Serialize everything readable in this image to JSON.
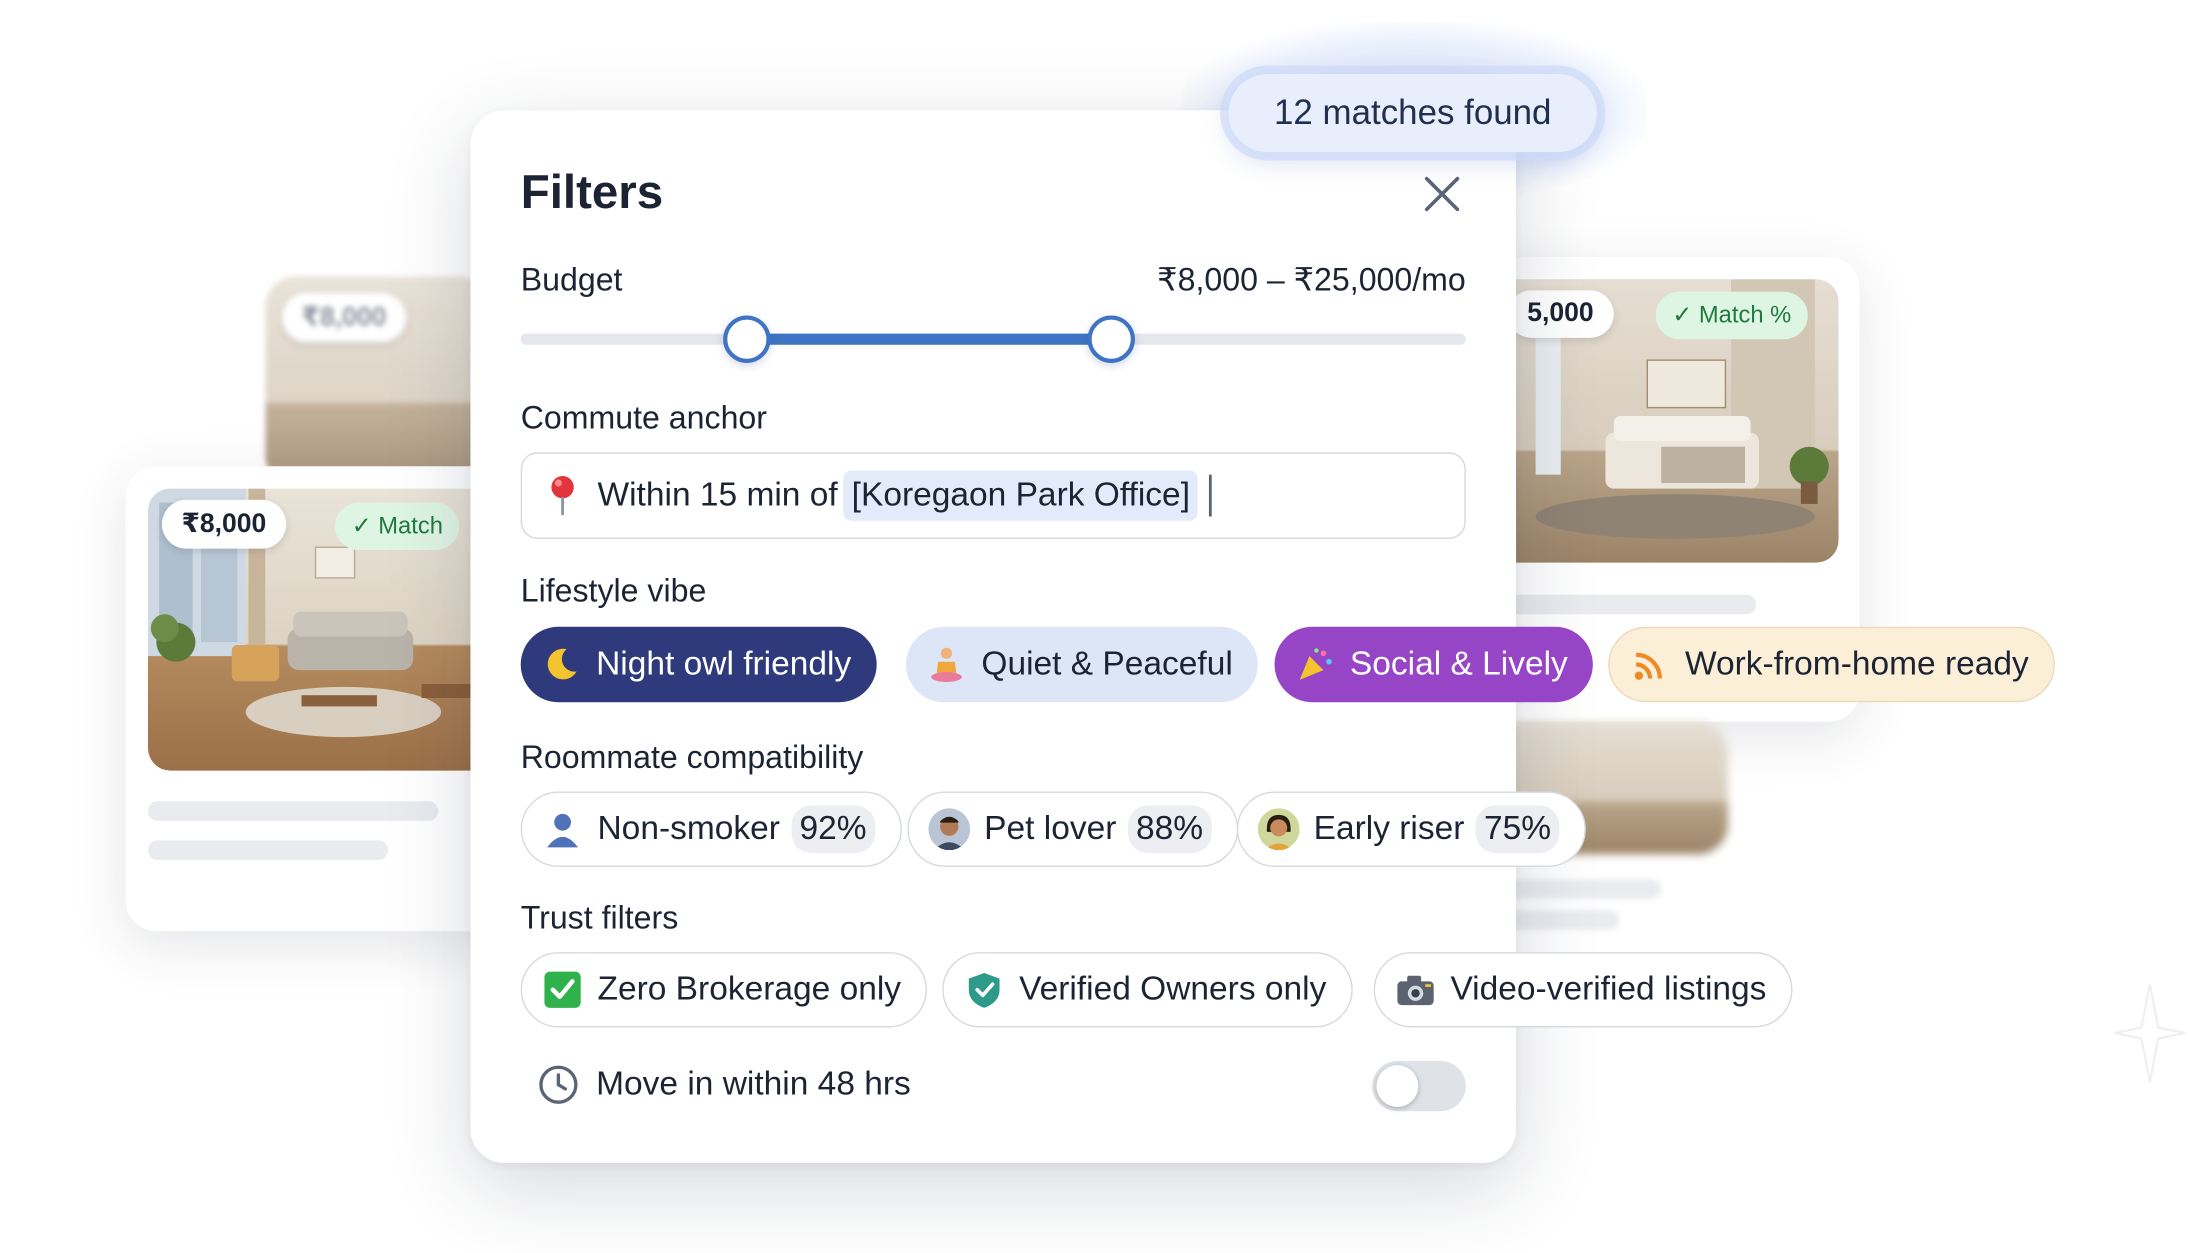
{
  "matches": {
    "label": "12 matches found"
  },
  "panel": {
    "title": "Filters",
    "budget": {
      "label": "Budget",
      "range": "₹8,000 – ₹25,000/mo",
      "min_fraction": 0.24,
      "max_fraction": 0.63
    },
    "commute": {
      "label": "Commute anchor",
      "prefix": "Within 15 min of",
      "place": "[Koregaon Park Office]"
    },
    "lifestyle": {
      "label": "Lifestyle vibe",
      "chips": [
        {
          "label": "Night owl friendly",
          "icon": "moon-icon",
          "selected": true,
          "color": "#2f3a7c"
        },
        {
          "label": "Quiet & Peaceful",
          "icon": "meditation-icon",
          "selected": false,
          "color": "#dde6f6"
        },
        {
          "label": "Social & Lively",
          "icon": "party-popper-icon",
          "selected": true,
          "color": "#9645c7"
        },
        {
          "label": "Work-from-home ready",
          "icon": "wifi-icon",
          "selected": false,
          "color": "#fbefd8"
        }
      ]
    },
    "roommate": {
      "label": "Roommate compatibility",
      "chips": [
        {
          "label": "Non-smoker",
          "percent": "92%",
          "icon": "person-icon"
        },
        {
          "label": "Pet lover",
          "percent": "88%",
          "icon": "avatar-man-icon"
        },
        {
          "label": "Early riser",
          "percent": "75%",
          "icon": "avatar-woman-icon"
        }
      ]
    },
    "trust": {
      "label": "Trust filters",
      "chips": [
        {
          "label": "Zero Brokerage only",
          "icon": "check-box-icon"
        },
        {
          "label": "Verified Owners only",
          "icon": "shield-check-icon"
        },
        {
          "label": "Video-verified listings",
          "icon": "camera-icon"
        }
      ]
    },
    "move_in": {
      "label": "Move in within 48 hrs",
      "enabled": false
    }
  },
  "listings": [
    {
      "price": "₹8,000",
      "match": "Match"
    },
    {
      "price": "₹8,000",
      "match": "Match %"
    },
    {
      "price": "5,000",
      "match": "Match %"
    }
  ],
  "colors": {
    "accent": "#3f74c4",
    "match_green": "#1f7a3d"
  }
}
